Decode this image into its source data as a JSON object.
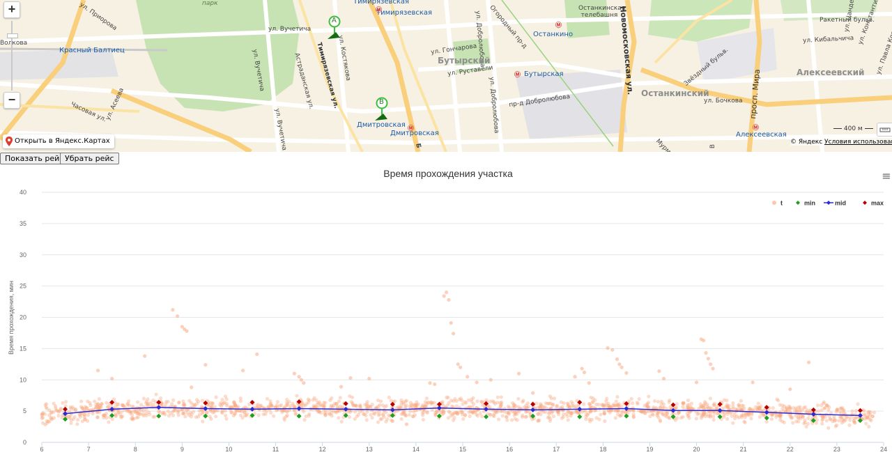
{
  "map": {
    "zoom_in": "+",
    "zoom_out": "−",
    "open_link": "Открыть в Яндекс.Картах",
    "scale_label": "400 м",
    "copyright": "© Яндекс",
    "terms": "Условия использования",
    "pins": [
      {
        "label": "A"
      },
      {
        "label": "B"
      }
    ],
    "labels": {
      "park": "парк",
      "volkova": "Волкова",
      "prior": "ул. Приорова",
      "krasny": "Красный Балтиец",
      "vuchet1": "ул. Вучетича",
      "vuchet2": "ул. Вучетича",
      "vuchet3": "ул. Вучетича",
      "kost": "ул. Костякова",
      "astr": "Астраданская ул.",
      "timir_st": "Тимирязевская ул.",
      "timir1": "Тимирязевская",
      "timir2": "Тимирязевская",
      "gonch": "ул. Гончарова",
      "dobrol1": "ул. Добролюбова",
      "dobrol2": "ул. Добролюбова",
      "dobrol3": "пр-д Добролюбова",
      "ogorod": "Огородный пр-д",
      "butyr": "Бутырский",
      "rust": "ул. Руставели",
      "butyr_st": "Бутырская",
      "ostank1": "Останкино",
      "ostank_tv": "Останкинская телебашня",
      "novomosk": "Новомосковская ул.",
      "dmitr1": "Дмитровская",
      "dmitr2": "Дмитровская",
      "chasov": "Часовая ул.",
      "aseeva": "ул. Асеева",
      "ostank_d": "Останкинский",
      "bochkova": "ул. Бочкова",
      "zvezd": "Звёздный бульв.",
      "mira": "просп. Мира",
      "alekseev_d": "Алексеевский",
      "alekseev_st": "Алексеевская",
      "kibal": "ул. Кибальчича",
      "raket": "Ракетный бульв.",
      "konst": "ул. Константинова",
      "pavla": "ул. Павла Корчагина",
      "tsand": "ул. Цандера",
      "murm": "Мурм...",
      "vu1": "В",
      "br": "Б"
    }
  },
  "buttons": {
    "show": "Показать рейс",
    "remove": "Убрать рейс"
  },
  "chart_data": {
    "type": "scatter",
    "title": "Время прохождения участка",
    "ylabel": "Время прохождения, мин",
    "xlabel": "",
    "xlim": [
      6,
      24
    ],
    "ylim": [
      0,
      40
    ],
    "xticks": [
      6,
      7,
      8,
      9,
      10,
      11,
      12,
      13,
      14,
      15,
      16,
      17,
      18,
      19,
      20,
      21,
      22,
      23,
      24
    ],
    "yticks": [
      0,
      5,
      10,
      15,
      20,
      25,
      30,
      35,
      40
    ],
    "grid": true,
    "legend_position": "top-right",
    "menu_icon": "≡",
    "colors": {
      "t": "#f7a27a",
      "min": "#1e9e1e",
      "mid": "#2b2bd6",
      "max": "#b50000",
      "grid": "#e6e6e6",
      "axis": "#ccd6eb"
    },
    "series": [
      {
        "name": "t",
        "kind": "scatter",
        "note_points": "dense cloud of individual trip times, roughly 3–7 min across all hours with outliers",
        "outliers": [
          [
            7.2,
            11.5
          ],
          [
            7.5,
            10.2
          ],
          [
            8.2,
            13.8
          ],
          [
            8.8,
            21.2
          ],
          [
            8.9,
            20.2
          ],
          [
            9.0,
            18.5
          ],
          [
            9.05,
            18.1
          ],
          [
            9.1,
            17.8
          ],
          [
            9.2,
            8.8
          ],
          [
            9.5,
            12.4
          ],
          [
            10.3,
            11.5
          ],
          [
            10.6,
            14.1
          ],
          [
            11.4,
            11.0
          ],
          [
            11.5,
            10.5
          ],
          [
            11.55,
            10.0
          ],
          [
            11.6,
            9.5
          ],
          [
            12.4,
            8.9
          ],
          [
            12.6,
            10.3
          ],
          [
            13.0,
            10.2
          ],
          [
            13.5,
            3.4
          ],
          [
            13.8,
            2.9
          ],
          [
            14.3,
            9.5
          ],
          [
            14.4,
            9.3
          ],
          [
            14.6,
            23.4
          ],
          [
            14.65,
            24.0
          ],
          [
            14.7,
            22.8
          ],
          [
            14.75,
            19.1
          ],
          [
            14.8,
            17.4
          ],
          [
            14.9,
            12.5
          ],
          [
            14.95,
            12.0
          ],
          [
            15.1,
            10.5
          ],
          [
            15.3,
            9.6
          ],
          [
            15.6,
            10.0
          ],
          [
            16.2,
            11.0
          ],
          [
            16.5,
            7.9
          ],
          [
            17.4,
            10.5
          ],
          [
            17.55,
            11.8
          ],
          [
            17.6,
            11.2
          ],
          [
            17.7,
            9.5
          ],
          [
            18.1,
            15.1
          ],
          [
            18.2,
            14.8
          ],
          [
            18.3,
            13.3
          ],
          [
            18.35,
            12.5
          ],
          [
            18.4,
            12.0
          ],
          [
            18.5,
            11.1
          ],
          [
            19.2,
            11.4
          ],
          [
            19.3,
            10.2
          ],
          [
            20.1,
            16.5
          ],
          [
            20.15,
            16.3
          ],
          [
            20.2,
            14.3
          ],
          [
            20.25,
            13.4
          ],
          [
            20.3,
            12.5
          ],
          [
            20.35,
            11.8
          ],
          [
            20.0,
            9.6
          ],
          [
            21.2,
            9.6
          ],
          [
            22.4,
            12.8
          ],
          [
            22.0,
            8.5
          ]
        ]
      },
      {
        "name": "min",
        "kind": "markers",
        "x": [
          6.5,
          7.5,
          8.5,
          9.5,
          10.5,
          11.5,
          12.5,
          13.5,
          14.5,
          15.5,
          16.5,
          17.5,
          18.5,
          19.5,
          20.5,
          21.5,
          22.5,
          23.5
        ],
        "values": [
          3.7,
          4.3,
          4.2,
          4.2,
          4.3,
          4.2,
          4.3,
          4.3,
          4.2,
          4.1,
          4.2,
          4.1,
          4.2,
          4.1,
          4.1,
          3.9,
          3.5,
          3.5
        ]
      },
      {
        "name": "mid",
        "kind": "line",
        "x": [
          6.5,
          7.5,
          8.5,
          9.5,
          10.5,
          11.5,
          12.5,
          13.5,
          14.5,
          15.5,
          16.5,
          17.5,
          18.5,
          19.5,
          20.5,
          21.5,
          22.5,
          23.5
        ],
        "values": [
          4.6,
          5.3,
          5.6,
          5.4,
          5.3,
          5.4,
          5.3,
          5.2,
          5.5,
          5.3,
          5.2,
          5.3,
          5.4,
          5.1,
          5.1,
          4.8,
          4.5,
          4.3
        ]
      },
      {
        "name": "max",
        "kind": "markers",
        "x": [
          6.5,
          7.5,
          8.5,
          9.5,
          10.5,
          11.5,
          12.5,
          13.5,
          14.5,
          15.5,
          16.5,
          17.5,
          18.5,
          19.5,
          20.5,
          21.5,
          22.5,
          23.5
        ],
        "values": [
          5.3,
          6.4,
          6.4,
          6.3,
          6.4,
          6.5,
          6.2,
          6.1,
          6.1,
          6.2,
          6.1,
          6.4,
          6.2,
          6.0,
          6.1,
          5.6,
          5.2,
          5.1
        ]
      }
    ]
  }
}
